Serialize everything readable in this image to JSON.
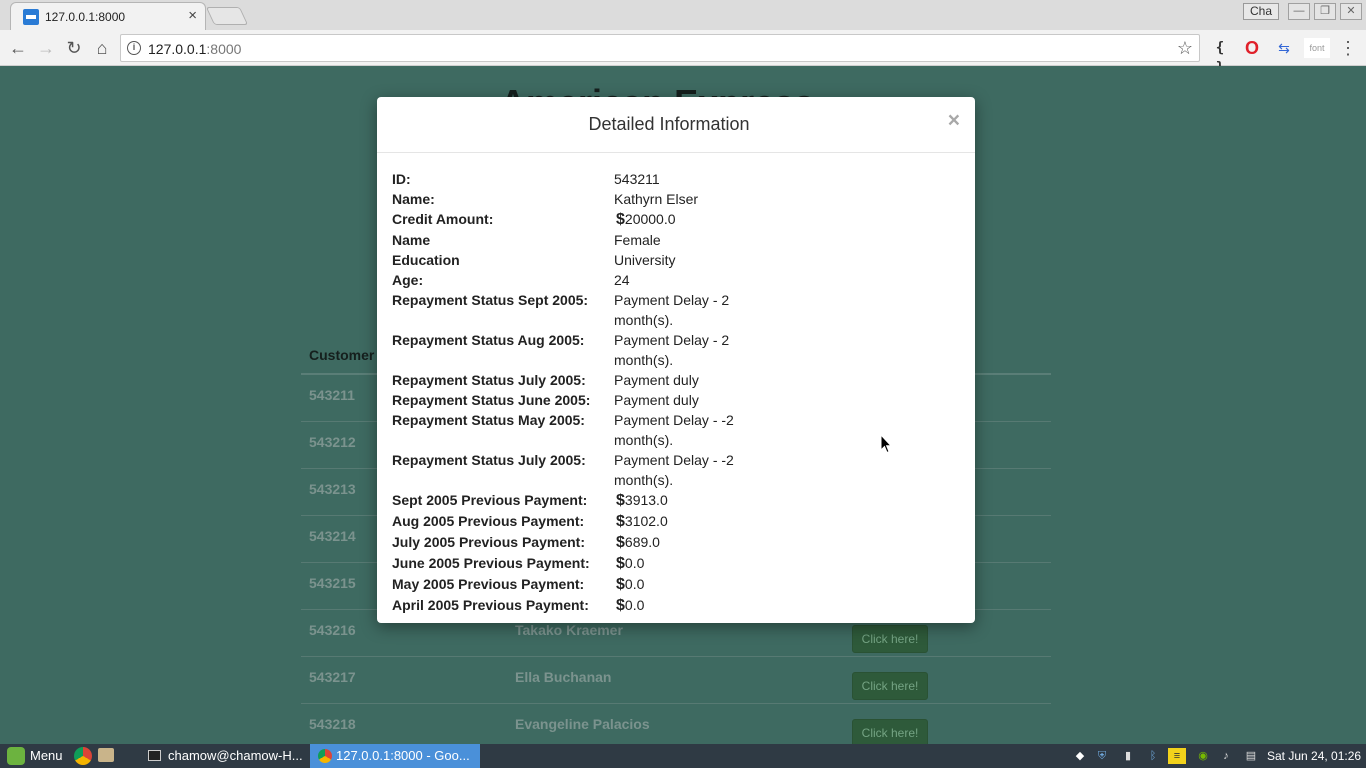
{
  "browser": {
    "tab_title": "127.0.0.1:8000",
    "tab_close": "×",
    "profile": "Cha",
    "window_controls": {
      "minimize": "—",
      "maximize": "❐",
      "close": "✕"
    },
    "nav": {
      "back": "←",
      "forward": "→",
      "reload": "↻",
      "home": "⌂"
    },
    "url_host": "127.0.0.1",
    "url_port": ":8000",
    "bookmark_icon": "☆",
    "extensions": {
      "json": "{ }",
      "opera": "O",
      "translate": "⇆",
      "font": "font"
    },
    "menu": "⋮"
  },
  "page": {
    "heading": "American Express",
    "table_header_customer": "Customer",
    "rows": [
      {
        "id": "543211",
        "name": "",
        "button": ""
      },
      {
        "id": "543212",
        "name": "",
        "button": ""
      },
      {
        "id": "543213",
        "name": "",
        "button": ""
      },
      {
        "id": "543214",
        "name": "",
        "button": ""
      },
      {
        "id": "543215",
        "name": "",
        "button": ""
      },
      {
        "id": "543216",
        "name": "Takako Kraemer",
        "button": "Click here!"
      },
      {
        "id": "543217",
        "name": "Ella Buchanan",
        "button": "Click here!"
      },
      {
        "id": "543218",
        "name": "Evangeline Palacios",
        "button": "Click here!"
      }
    ]
  },
  "modal": {
    "title": "Detailed Information",
    "close": "×",
    "fields": [
      {
        "label": "ID:",
        "value": "543211",
        "currency": ""
      },
      {
        "label": "Name:",
        "value": "Kathyrn Elser",
        "currency": ""
      },
      {
        "label": "Credit Amount:",
        "value": "20000.0",
        "currency": "$"
      },
      {
        "label": "Name",
        "value": "Female",
        "currency": ""
      },
      {
        "label": "Education",
        "value": "University",
        "currency": ""
      },
      {
        "label": "Age:",
        "value": "24",
        "currency": ""
      },
      {
        "label": "Repayment Status Sept 2005:",
        "value": "Payment Delay - 2 month(s).",
        "currency": ""
      },
      {
        "label": "Repayment Status Aug 2005:",
        "value": "Payment Delay - 2 month(s).",
        "currency": ""
      },
      {
        "label": "Repayment Status July 2005:",
        "value": "Payment duly",
        "currency": ""
      },
      {
        "label": "Repayment Status June 2005:",
        "value": "Payment duly",
        "currency": ""
      },
      {
        "label": "Repayment Status May 2005:",
        "value": "Payment Delay - -2 month(s).",
        "currency": ""
      },
      {
        "label": "Repayment Status July 2005:",
        "value": "Payment Delay - -2 month(s).",
        "currency": ""
      },
      {
        "label": "Sept 2005 Previous Payment:",
        "value": "3913.0",
        "currency": "$"
      },
      {
        "label": "Aug 2005 Previous Payment:",
        "value": "3102.0",
        "currency": "$"
      },
      {
        "label": "July 2005 Previous Payment:",
        "value": "689.0",
        "currency": "$"
      },
      {
        "label": "June 2005 Previous Payment:",
        "value": "0.0",
        "currency": "$"
      },
      {
        "label": "May 2005 Previous Payment:",
        "value": "0.0",
        "currency": "$"
      },
      {
        "label": "April 2005 Previous Payment:",
        "value": "0.0",
        "currency": "$"
      }
    ]
  },
  "taskbar": {
    "menu_label": "Menu",
    "terminal_task": "chamow@chamow-H...",
    "browser_task": "127.0.0.1:8000 - Goo...",
    "tray_icons": [
      "dropbox-icon",
      "shield-icon",
      "network-icon",
      "bluetooth-icon",
      "notes-icon",
      "nvidia-icon",
      "volume-icon",
      "clipboard-icon"
    ],
    "clock": "Sat Jun 24, 01:26"
  },
  "colors": {
    "page_background": "#3e6a61",
    "button_green": "#2e5a3a",
    "taskbar": "#2f3a44",
    "active_task": "#4a90d9"
  }
}
